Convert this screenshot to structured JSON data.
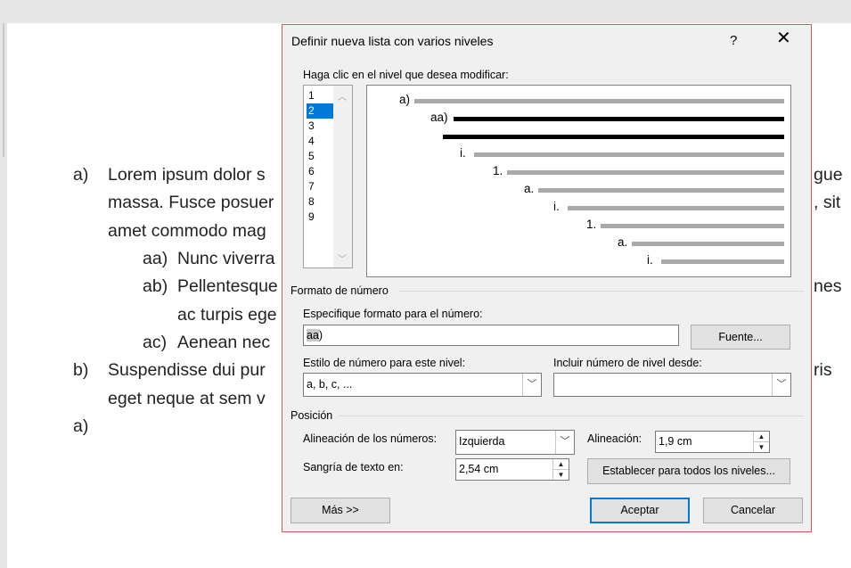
{
  "document": {
    "lines": [
      {
        "label": "a)",
        "text": "Lorem ipsum dolor s",
        "right_text": "gue"
      },
      {
        "label": "",
        "text": "massa. Fusce posuer",
        "right_text": ", sit"
      },
      {
        "label": "",
        "text": "amet commodo mag",
        "right_text": ""
      },
      {
        "label": "aa)",
        "text": "Nunc viverra",
        "right_text": ""
      },
      {
        "label": "ab)",
        "text": "Pellentesque",
        "right_text": "nes"
      },
      {
        "label": "",
        "text": "ac turpis ege",
        "right_text": ""
      },
      {
        "label": "ac)",
        "text": "Aenean nec",
        "right_text": ""
      },
      {
        "label": "b)",
        "text": "Suspendisse dui pur",
        "right_text": "ris"
      },
      {
        "label": "",
        "text": "eget neque at sem v",
        "right_text": ""
      },
      {
        "label": "a)",
        "text": "",
        "right_text": ""
      }
    ]
  },
  "dialog": {
    "title": "Definir nueva lista con varios niveles",
    "help": "?",
    "close": "✕",
    "level_prompt": "Haga clic en el nivel que desea modificar:",
    "levels": [
      "1",
      "2",
      "3",
      "4",
      "5",
      "6",
      "7",
      "8",
      "9"
    ],
    "selected_level": "2",
    "preview_labels": [
      "a)",
      "aa)",
      "",
      "i.",
      "1.",
      "a.",
      "i.",
      "1.",
      "a.",
      "i."
    ],
    "number_format_section": "Formato de número",
    "format_prompt": "Especifique formato para el número:",
    "format_value_highlight": "aa",
    "format_value_rest": ")",
    "font_button": "Fuente...",
    "style_label": "Estilo de número para este nivel:",
    "style_value": "a, b, c, ...",
    "include_label": "Incluir número de nivel desde:",
    "include_value": "",
    "position_section": "Posición",
    "number_alignment_label": "Alineación de los números:",
    "number_alignment_value": "Izquierda",
    "alignment_label": "Alineación:",
    "alignment_value": "1,9 cm",
    "indent_label": "Sangría de texto en:",
    "indent_value": "2,54 cm",
    "set_all_button": "Establecer para todos los niveles...",
    "more_button": "Más >>",
    "accept_button": "Aceptar",
    "cancel_button": "Cancelar"
  },
  "colors": {
    "selection": "#0078d7",
    "dialog_border": "#c95b5b",
    "dialog_bg": "#f0f0f0"
  }
}
